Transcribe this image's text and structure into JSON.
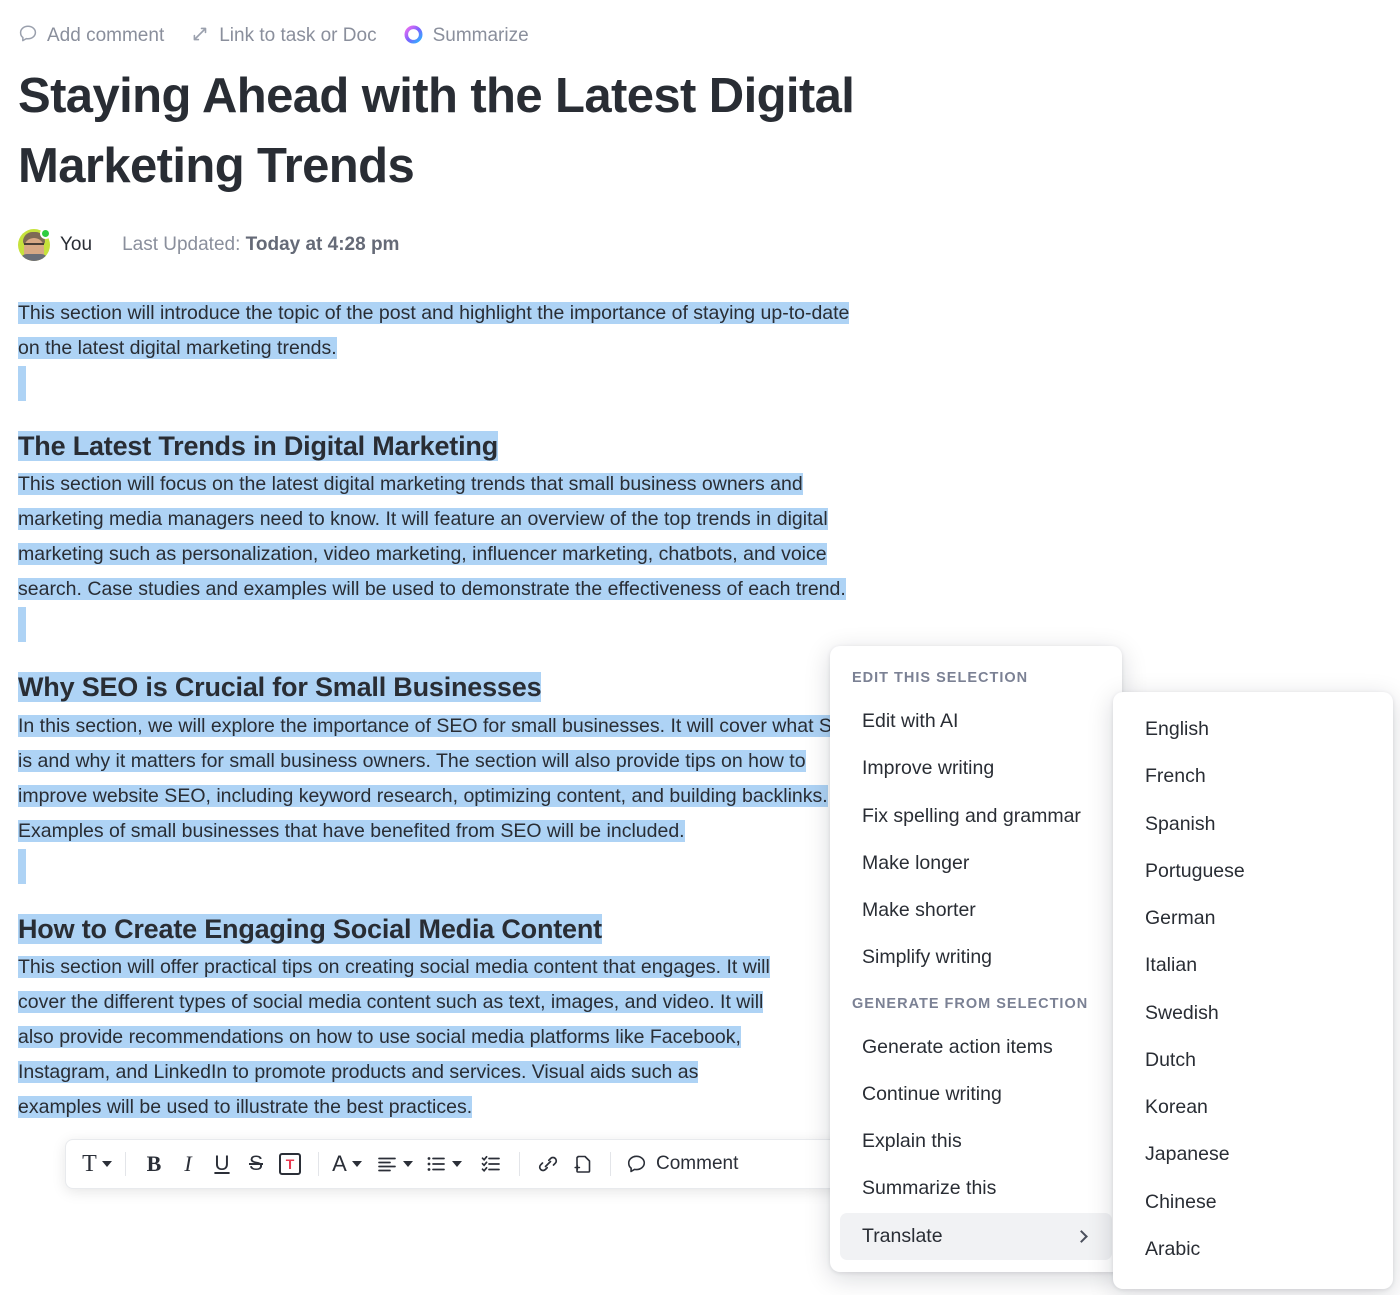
{
  "topbar": {
    "items": [
      {
        "label": "Add comment",
        "icon": "comment-bubble-icon"
      },
      {
        "label": "Link to task or Doc",
        "icon": "link-arrow-icon"
      },
      {
        "label": "Summarize",
        "icon": "ai-ring-icon"
      }
    ]
  },
  "document": {
    "title": "Staying Ahead with the Latest Digital Marketing Trends",
    "author": "You",
    "updated_prefix": "Last Updated:",
    "updated_value": "Today at 4:28 pm",
    "blocks": [
      {
        "type": "paragraph",
        "lines": [
          "This section will introduce the topic of the post and highlight the importance of staying up-to-date",
          "on the latest digital marketing trends."
        ]
      },
      {
        "type": "heading",
        "text": "The Latest Trends in Digital Marketing"
      },
      {
        "type": "paragraph",
        "lines": [
          "This section will focus on the latest digital marketing trends that small business owners and",
          "marketing media managers need to know. It will feature an overview of the top trends in digital",
          "marketing such as personalization, video marketing, influencer marketing, chatbots, and voice",
          "search. Case studies and examples will be used to demonstrate the effectiveness of each trend."
        ]
      },
      {
        "type": "heading",
        "text": "Why SEO is Crucial for Small Businesses"
      },
      {
        "type": "paragraph",
        "lines": [
          "In this section, we will explore the importance of SEO for small businesses. It will cover what SEO",
          "is and why it matters for small business owners. The section will also provide tips on how to",
          "improve website SEO, including keyword research, optimizing content, and building backlinks.",
          "Examples of small businesses that have benefited from SEO will be included."
        ]
      },
      {
        "type": "heading",
        "text": "How to Create Engaging Social Media Content"
      },
      {
        "type": "paragraph",
        "lines": [
          "This section will offer practical tips on creating social media content that engages. It will",
          "cover the different types of social media content such as text, images, and video. It will",
          "also provide recommendations on how to use social media platforms like Facebook,",
          "Instagram, and LinkedIn to promote products and services. Visual aids such as",
          "examples will be used to illustrate the best practices."
        ]
      }
    ]
  },
  "format_toolbar": {
    "text_style_label": "T",
    "bold_label": "B",
    "italic_label": "I",
    "underline_label": "U",
    "strike_label": "S",
    "highlight_label": "T",
    "font_color_label": "A",
    "comment_label": "Comment"
  },
  "ai_menu": {
    "section_one_label": "EDIT THIS SELECTION",
    "section_one_items": [
      "Edit with AI",
      "Improve writing",
      "Fix spelling and grammar",
      "Make longer",
      "Make shorter",
      "Simplify writing"
    ],
    "section_two_label": "GENERATE FROM SELECTION",
    "section_two_items": [
      "Generate action items",
      "Continue writing",
      "Explain this",
      "Summarize this",
      "Translate"
    ],
    "active_item": "Translate"
  },
  "language_menu": {
    "items": [
      "English",
      "French",
      "Spanish",
      "Portuguese",
      "German",
      "Italian",
      "Swedish",
      "Dutch",
      "Korean",
      "Japanese",
      "Chinese",
      "Arabic"
    ]
  },
  "colors": {
    "selection_highlight": "#aed3f5",
    "text_primary": "#292d34",
    "text_muted": "#8a8f9c",
    "menu_active": "#f1f2f4",
    "accent_red": "#e8384f",
    "presence_green": "#2ecc40"
  }
}
